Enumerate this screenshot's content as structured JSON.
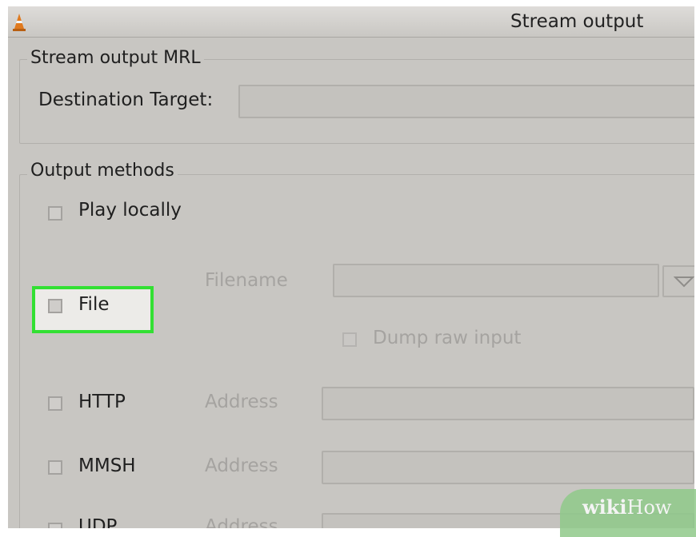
{
  "window": {
    "title": "Stream output"
  },
  "mrl": {
    "legend": "Stream output MRL",
    "destination_label": "Destination Target:",
    "destination_value": ""
  },
  "methods": {
    "legend": "Output methods",
    "play_locally": "Play locally",
    "file": {
      "label": "File",
      "filename_label": "Filename",
      "filename_value": "",
      "dump_raw": "Dump raw input"
    },
    "http": {
      "label": "HTTP",
      "address_label": "Address",
      "address_value": ""
    },
    "mmsh": {
      "label": "MMSH",
      "address_label": "Address",
      "address_value": ""
    },
    "udp": {
      "label": "UDP",
      "address_label": "Address",
      "address_value": ""
    }
  },
  "watermark": {
    "wiki": "wiki",
    "how": "How"
  },
  "colors": {
    "highlight": "#33e033",
    "window_bg": "#c8c6c2"
  }
}
